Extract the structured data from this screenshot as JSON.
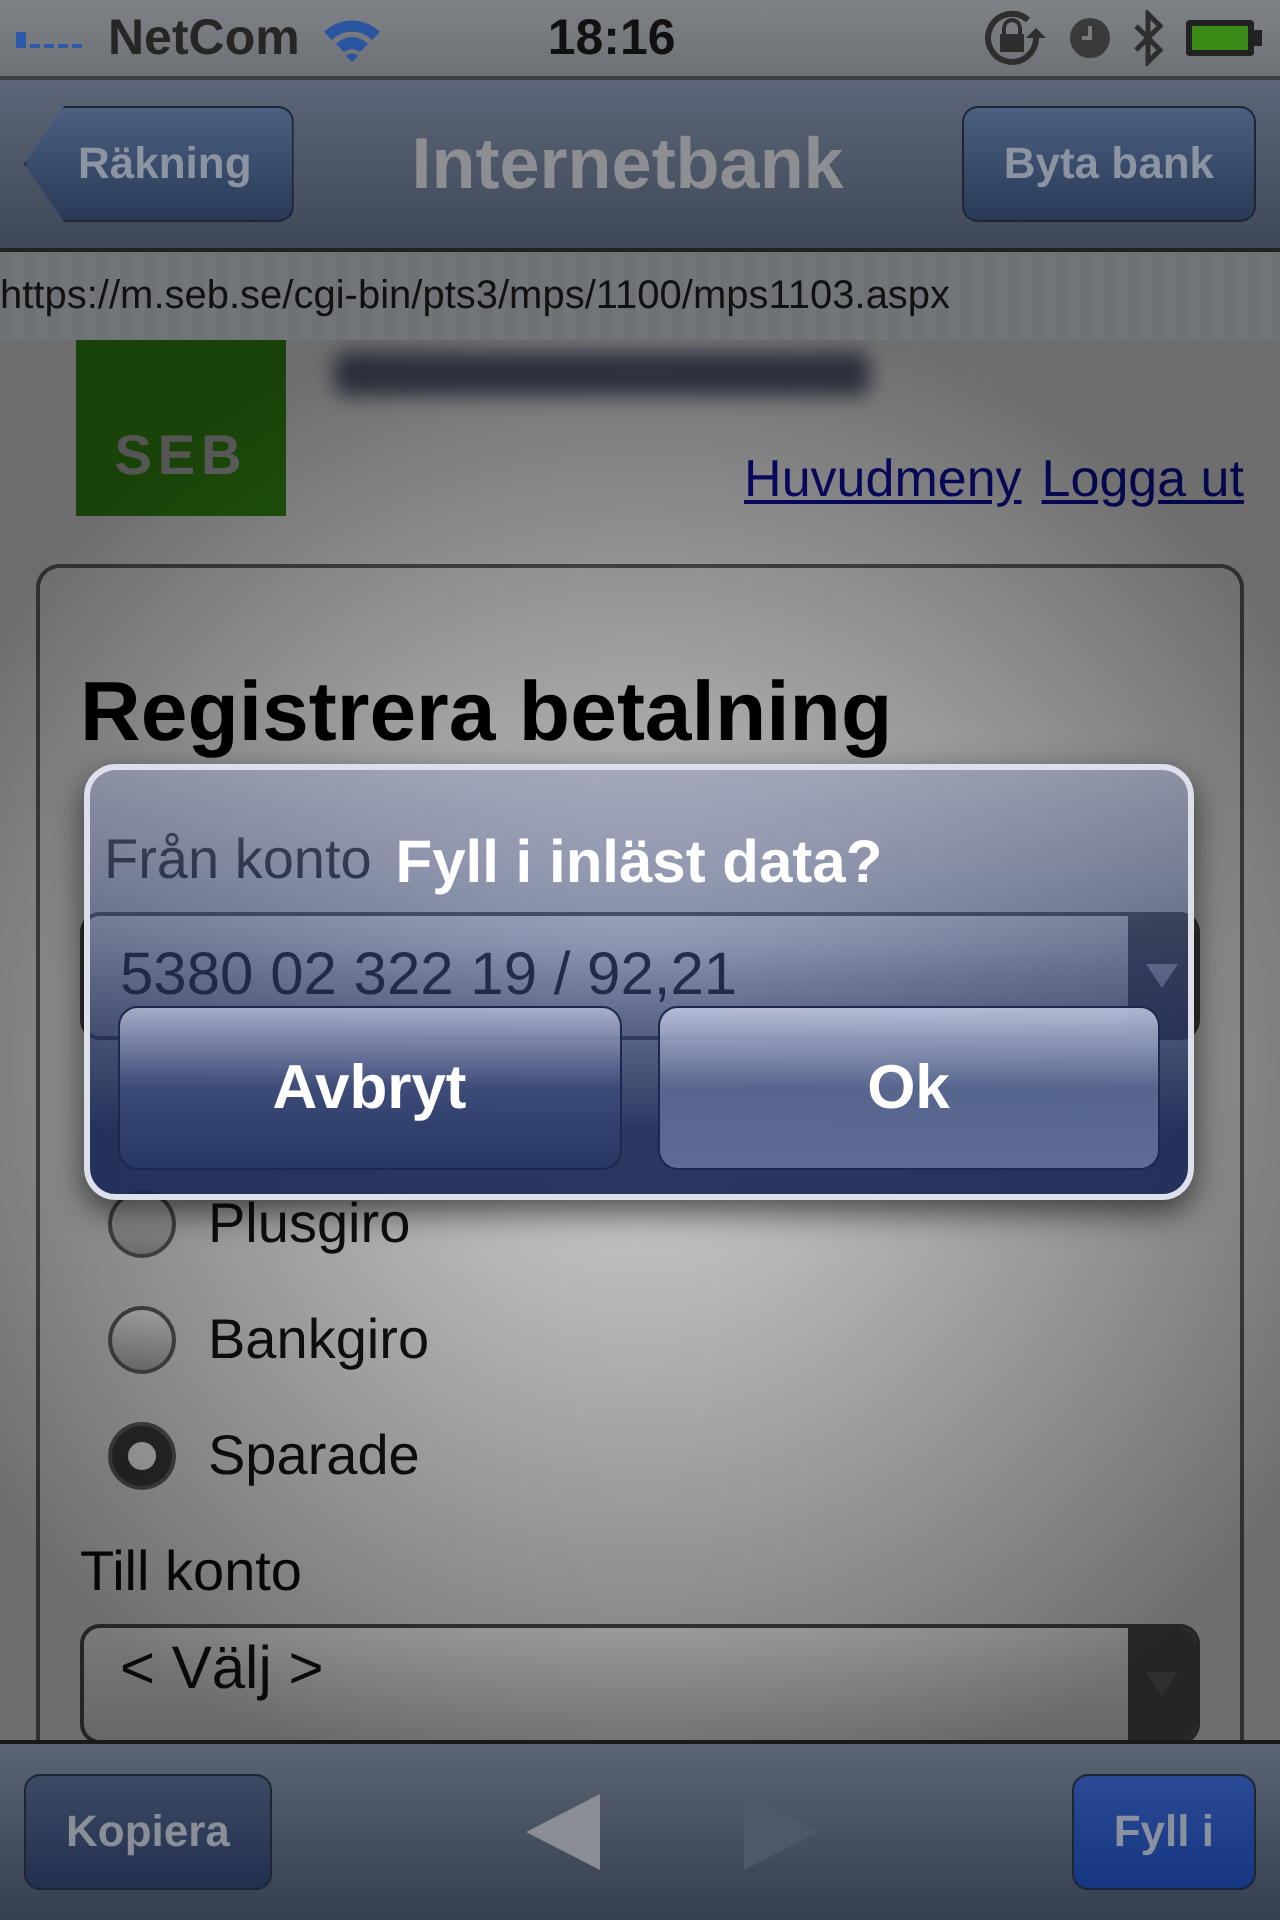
{
  "status_bar": {
    "carrier": "NetCom",
    "time": "18:16"
  },
  "nav_bar": {
    "back_button": "Räkning",
    "title": "Internetbank",
    "right_button": "Byta bank"
  },
  "url_bar": {
    "url": "https://m.seb.se/cgi-bin/pts3/mps/1100/mps1103.aspx"
  },
  "page": {
    "logo": "SEB",
    "links": [
      "Huvudmeny",
      "Logga ut"
    ],
    "heading": "Registrera betalning",
    "from_label": "Från konto",
    "from_select": "5380 02 322 19 / 92,21",
    "radios": [
      {
        "label": "Plusgiro",
        "selected": false
      },
      {
        "label": "Bankgiro",
        "selected": false
      },
      {
        "label": "Sparade",
        "selected": true
      }
    ],
    "to_label": "Till konto",
    "to_select": "< Välj >"
  },
  "alert": {
    "title": "Fyll i inläst data?",
    "buttons": [
      {
        "label": "Avbryt",
        "kind": "cancel"
      },
      {
        "label": "Ok",
        "kind": "default"
      }
    ]
  },
  "toolbar": {
    "left_button": "Kopiera",
    "arrows": [
      {
        "kind": "back",
        "disabled": false
      },
      {
        "kind": "forward",
        "disabled": true
      }
    ],
    "right_button": "Fyll i"
  }
}
